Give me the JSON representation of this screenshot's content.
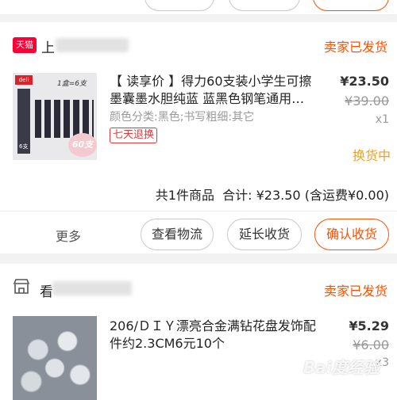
{
  "order1": {
    "shop_badge": "天猫",
    "shop_name_prefix": "上",
    "status": "卖家已发货",
    "product": {
      "brand_logo": "deli",
      "thumb_caption": "1盒=6支",
      "thumb_count": "6支",
      "thumb_promo": "60支",
      "title": "【 读享价 】得力60支装小学生可擦墨囊墨水胆纯蓝 蓝黑色钢笔通用…",
      "spec": "颜色分类:黑色;书写粗细:其它",
      "tag": "七天退换",
      "price": "¥23.50",
      "original_price": "¥39.00",
      "quantity": "x1",
      "after_sale_status": "换货中"
    },
    "summary": "共1件商品  合计: ¥23.50 (含运费¥0.00)",
    "actions": {
      "more": "更多",
      "logistics": "查看物流",
      "extend": "延长收货",
      "confirm": "确认收货"
    }
  },
  "order2": {
    "shop_name_prefix": "看",
    "status": "卖家已发货",
    "product": {
      "title": "206/ＤＩＹ漂亮合金满钻花盘发饰配件约2.3CM6元10个",
      "price": "¥5.29",
      "original_price": "¥6.00",
      "quantity": "x3"
    }
  },
  "watermark": "Bai度经验",
  "colors": {
    "accent": "#ff5000",
    "tag_red": "#e4393c",
    "muted": "#999999",
    "tmall_red": "#ff0036",
    "after_sale": "#f0a020"
  }
}
